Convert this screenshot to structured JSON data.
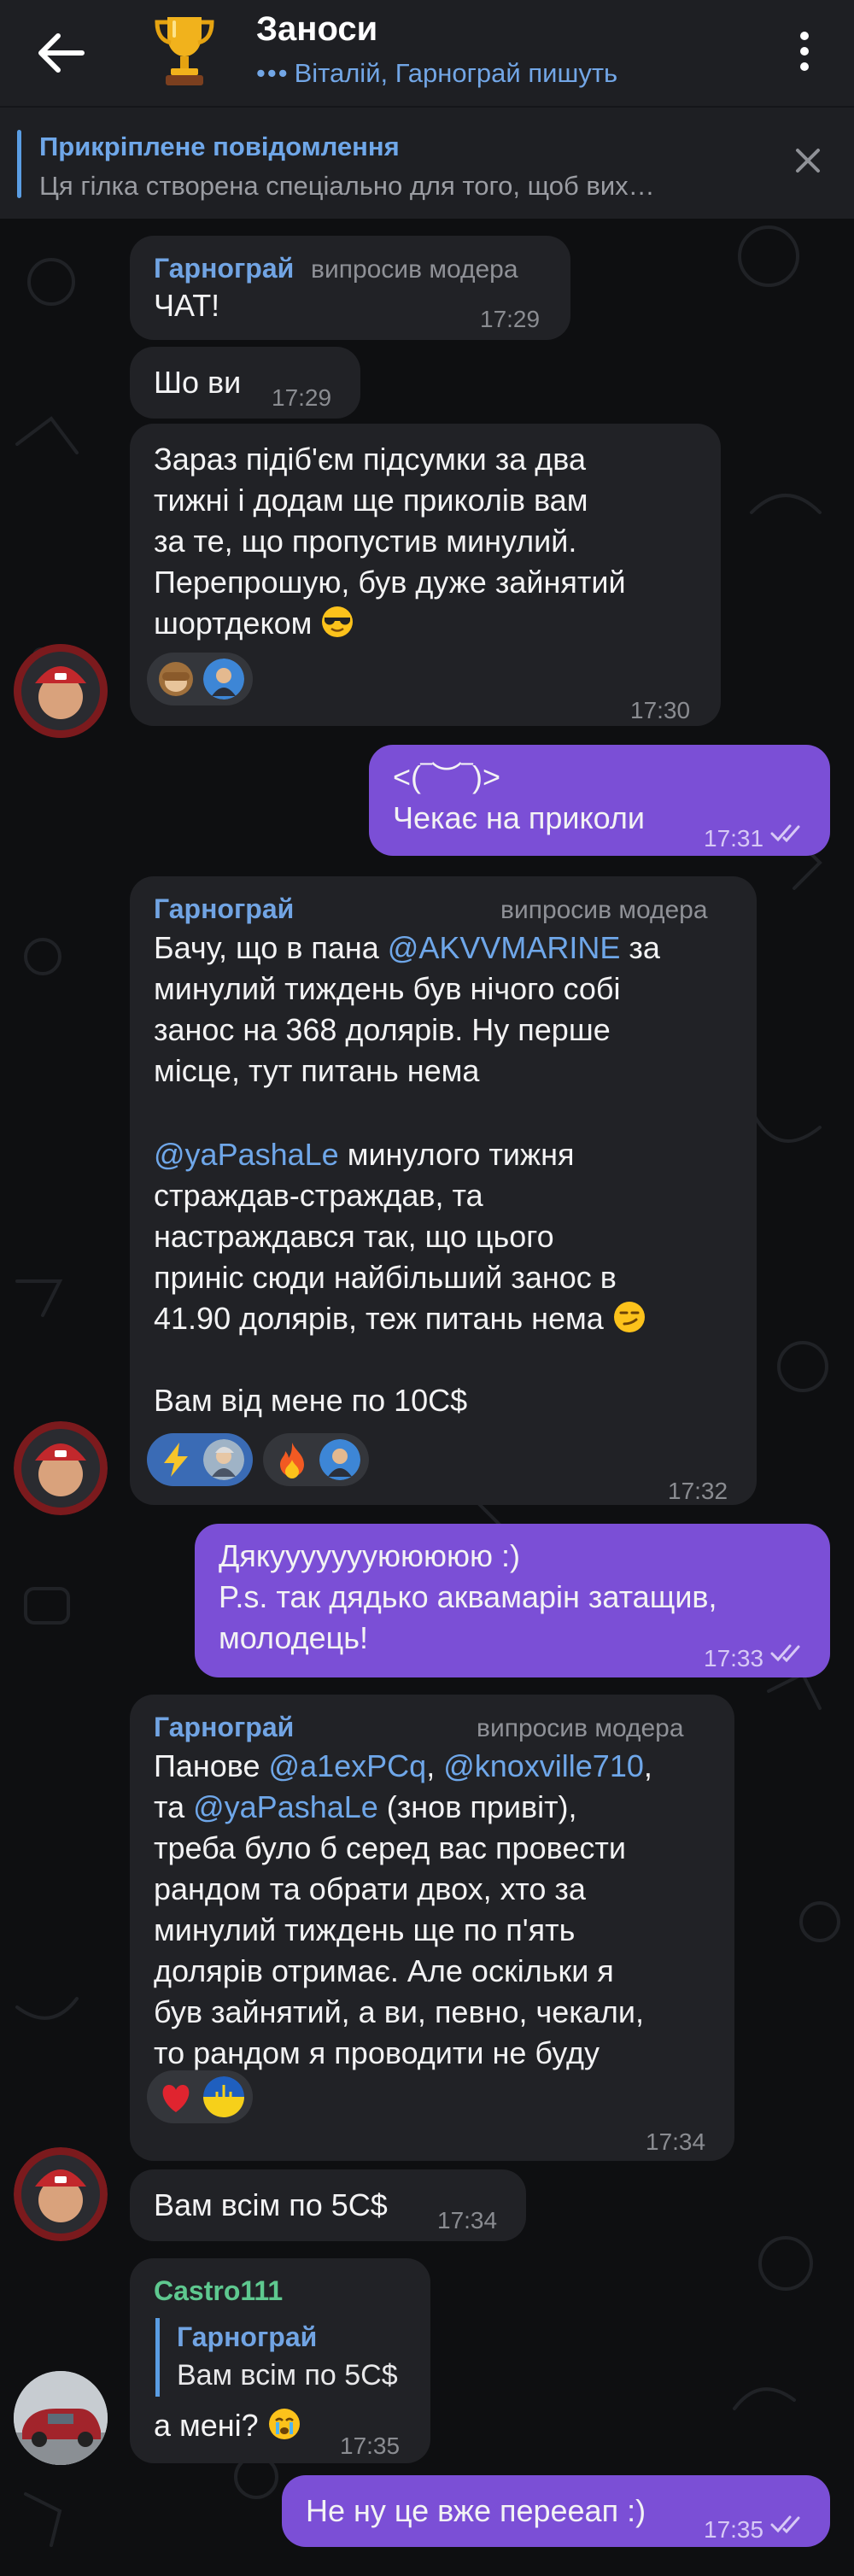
{
  "header": {
    "title": "Заноси",
    "typing_dots": "•••",
    "typing": "Віталій, Гарнограй пишуть"
  },
  "pinned": {
    "title": "Прикріплене повідомлення",
    "text": "Ця гілка створена спеціально для того, щоб вих…"
  },
  "messages": {
    "m1": {
      "sender": "Гарнограй",
      "role": "випросив модера",
      "text": "ЧАТ!",
      "time": "17:29"
    },
    "m2": {
      "text": "Шо ви",
      "time": "17:29"
    },
    "m3": {
      "text": "Зараз підіб'єм підсумки за два\nтижні і додам ще приколів вам\nза те, що пропустив минулий.\nПерепрошую, був дуже зайнятий\nшортдеком",
      "time": "17:30"
    },
    "m4": {
      "line1": "<(‾︶‾)>",
      "line2": "Чекає на приколи",
      "time": "17:31"
    },
    "m5": {
      "sender": "Гарнограй",
      "role": "випросив модера",
      "p1a": "Бачу, що в пана ",
      "mention1": "@AKVVMARINE",
      "p1b": " за\nминулий тиждень був нічого собі\nзанос на 368 долярів. Ну перше\nмісце, тут питань нема",
      "mention2": "@yaPashaLe",
      "p2": " минулого тижня\nстраждав-страждав, та\nнастраждався так, що цього\nприніс сюди найбільший занос в\n41.90 долярів, теж питань нема ",
      "p3": "Вам від мене по 10С$",
      "time": "17:32"
    },
    "m6": {
      "text": "Дякуууууууююююю :)\nP.s. так дядько аквамарін затащив,\nмолодець!",
      "time": "17:33"
    },
    "m7": {
      "sender": "Гарнограй",
      "role": "випросив модера",
      "t1": "Панове ",
      "mention1": "@a1exPCq",
      "t2": ", ",
      "mention2": "@knoxville710",
      "t3": ",\nта ",
      "mention3": "@yaPashaLe",
      "t4": " (знов привіт),\nтреба було б серед вас провести\nрандом та обрати двох, хто за\nминулий тиждень ще по п'ять\nдолярів отримає. Але оскільки я\nбув зайнятий, а ви, певно, чекали,\nто рандом я проводити не буду",
      "time": "17:34"
    },
    "m8": {
      "text": "Вам всім по 5С$",
      "time": "17:34"
    },
    "m9": {
      "sender": "Castro111",
      "reply_name": "Гарнограй",
      "reply_text": "Вам всім по 5С$",
      "text": "а мені? ",
      "time": "17:35"
    },
    "m10": {
      "text": "Не ну це вже перееап :)",
      "time": "17:35"
    }
  },
  "colors": {
    "background": "#0e0f11",
    "bar": "#1e1f23",
    "incoming_bubble": "#212226",
    "outgoing_bubble": "#7b4fd6",
    "accent": "#71a4e3"
  }
}
